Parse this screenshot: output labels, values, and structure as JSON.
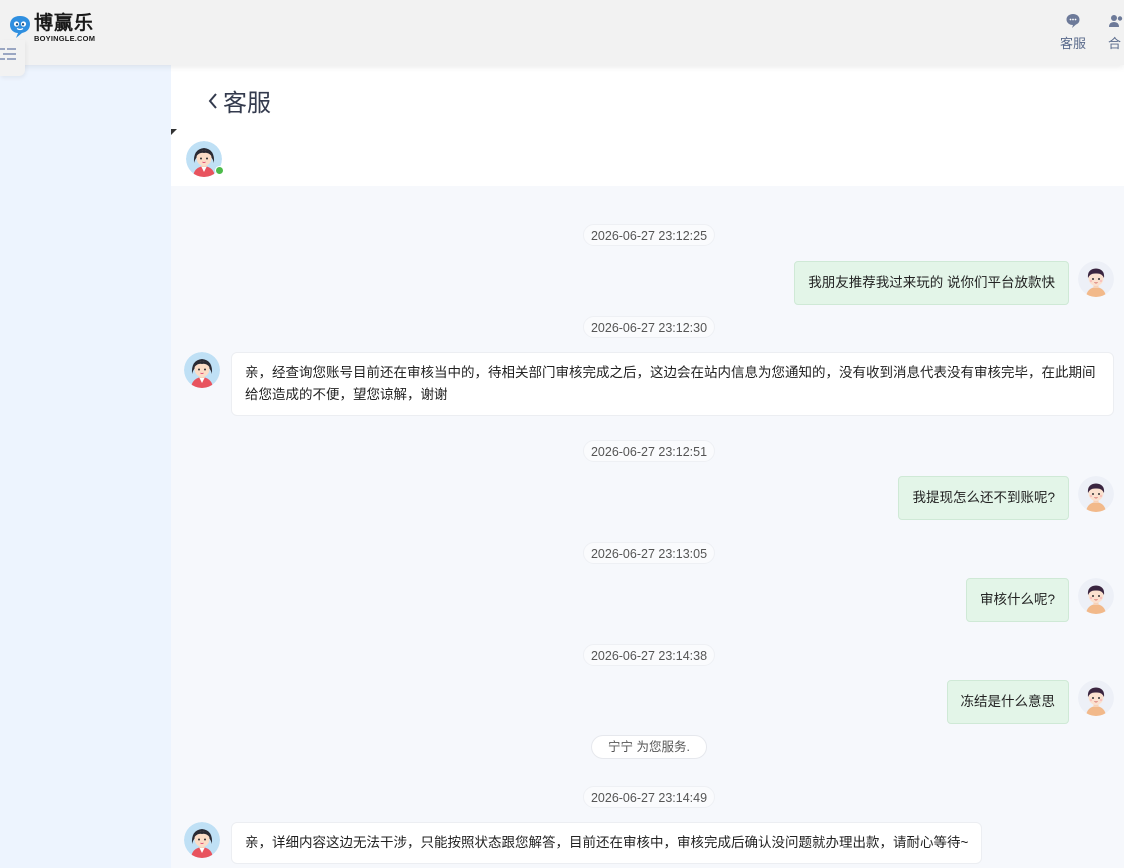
{
  "header": {
    "logo_cn": "博赢乐",
    "logo_en": "BOYINGLE.COM",
    "nav": [
      {
        "label": "客服",
        "icon": "chat-bubble-icon"
      },
      {
        "label": "合",
        "icon": "users-icon"
      }
    ]
  },
  "chat": {
    "title": "客服",
    "agent_status_color": "#4cbb4a",
    "messages": [
      {
        "time": "2026-06-27 23:12:25",
        "side": "user",
        "text": "我朋友推荐我过来玩的 说你们平台放款快"
      },
      {
        "time": "2026-06-27 23:12:30",
        "side": "agent",
        "text": "亲，经查询您账号目前还在审核当中的，待相关部门审核完成之后，这边会在站内信息为您通知的，没有收到消息代表没有审核完毕，在此期间给您造成的不便，望您谅解，谢谢"
      },
      {
        "time": "2026-06-27 23:12:51",
        "side": "user",
        "text": "我提现怎么还不到账呢?"
      },
      {
        "time": "2026-06-27 23:13:05",
        "side": "user",
        "text": "审核什么呢?"
      },
      {
        "time": "2026-06-27 23:14:38",
        "side": "user",
        "text": "冻结是什么意思"
      },
      {
        "system": "宁宁 为您服务."
      },
      {
        "time": "2026-06-27 23:14:49",
        "side": "agent",
        "text": "亲，详细内容这边无法干涉，只能按照状态跟您解答，目前还在审核中，审核完成后确认没问题就办理出款，请耐心等待~"
      }
    ]
  }
}
